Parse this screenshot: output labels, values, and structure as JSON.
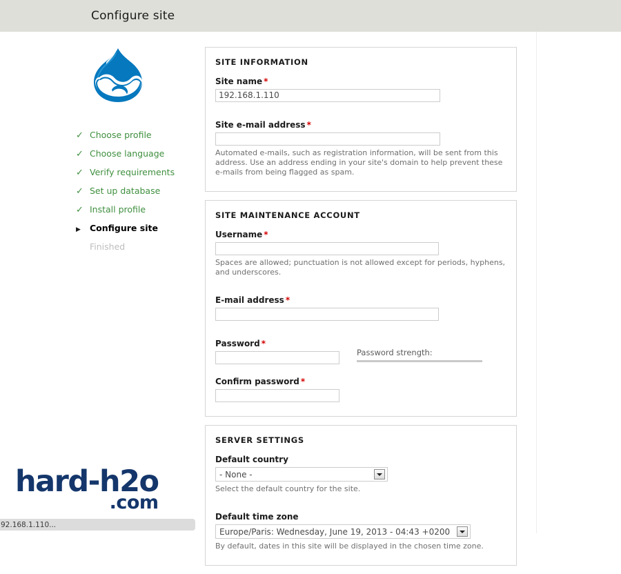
{
  "header": {
    "title": "Configure site"
  },
  "sidebar": {
    "logo_alt": "drupal-droplet-logo",
    "tasks": [
      {
        "label": "Choose profile",
        "state": "done",
        "marker": "✓"
      },
      {
        "label": "Choose language",
        "state": "done",
        "marker": "✓"
      },
      {
        "label": "Verify requirements",
        "state": "done",
        "marker": "✓"
      },
      {
        "label": "Set up database",
        "state": "done",
        "marker": "✓"
      },
      {
        "label": "Install profile",
        "state": "done",
        "marker": "✓"
      },
      {
        "label": "Configure site",
        "state": "active",
        "marker": "▶"
      },
      {
        "label": "Finished",
        "state": "pending",
        "marker": ""
      }
    ]
  },
  "site_information": {
    "legend": "SITE INFORMATION",
    "site_name": {
      "label": "Site name",
      "required": "*",
      "value": "192.168.1.110"
    },
    "site_email": {
      "label": "Site e-mail address",
      "required": "*",
      "value": "",
      "description": "Automated e-mails, such as registration information, will be sent from this address. Use an address ending in your site's domain to help prevent these e-mails from being flagged as spam."
    }
  },
  "maintenance_account": {
    "legend": "SITE MAINTENANCE ACCOUNT",
    "username": {
      "label": "Username",
      "required": "*",
      "value": "",
      "description": "Spaces are allowed; punctuation is not allowed except for periods, hyphens, and underscores."
    },
    "email": {
      "label": "E-mail address",
      "required": "*",
      "value": ""
    },
    "password": {
      "label": "Password",
      "required": "*",
      "value": ""
    },
    "confirm_password": {
      "label": "Confirm password",
      "required": "*",
      "value": ""
    },
    "password_strength": {
      "label": "Password strength:",
      "value": ""
    }
  },
  "server_settings": {
    "legend": "SERVER SETTINGS",
    "default_country": {
      "label": "Default country",
      "value": "- None -",
      "description": "Select the default country for the site."
    },
    "default_timezone": {
      "label": "Default time zone",
      "value": "Europe/Paris: Wednesday, June 19, 2013 - 04:43 +0200",
      "description": "By default, dates in this site will be displayed in the chosen time zone."
    }
  },
  "watermark": {
    "main": "hard-h2o",
    "sub": ".com"
  },
  "status_bar": {
    "text": "92.168.1.110..."
  },
  "colors": {
    "header_bg": "#dedfd8",
    "done_green": "#3f8f3f",
    "required_red": "#d40000",
    "watermark_navy": "#14366b",
    "panel_border": "#d5d5d5"
  }
}
